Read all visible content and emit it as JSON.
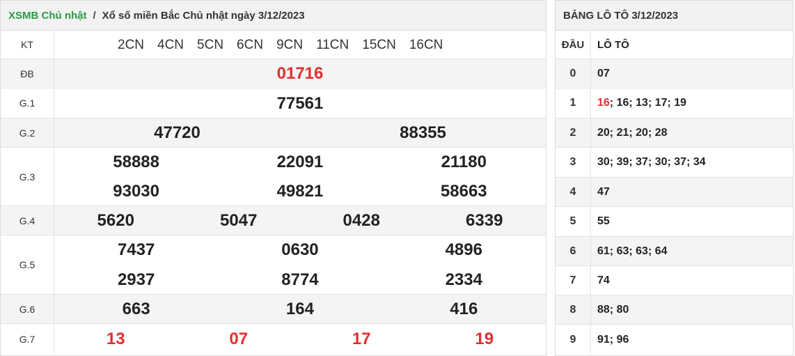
{
  "breadcrumb": {
    "home": "XSMB Chủ nhật",
    "separator": "/",
    "current": "Xổ số miền Bắc Chủ nhật ngày 3/12/2023"
  },
  "results": {
    "kt_label": "KT",
    "kt_codes": [
      "2CN",
      "4CN",
      "5CN",
      "6CN",
      "9CN",
      "11CN",
      "15CN",
      "16CN"
    ],
    "db": {
      "label": "ĐB",
      "values": [
        "01716"
      ]
    },
    "g1": {
      "label": "G.1",
      "values": [
        "77561"
      ]
    },
    "g2": {
      "label": "G.2",
      "values": [
        "47720",
        "88355"
      ]
    },
    "g3": {
      "label": "G.3",
      "values": [
        "58888",
        "22091",
        "21180",
        "93030",
        "49821",
        "58663"
      ]
    },
    "g4": {
      "label": "G.4",
      "values": [
        "5620",
        "5047",
        "0428",
        "6339"
      ]
    },
    "g5": {
      "label": "G.5",
      "values": [
        "7437",
        "0630",
        "4896",
        "2937",
        "8774",
        "2334"
      ]
    },
    "g6": {
      "label": "G.6",
      "values": [
        "663",
        "164",
        "416"
      ]
    },
    "g7": {
      "label": "G.7",
      "values": [
        "13",
        "07",
        "17",
        "19"
      ]
    }
  },
  "loto": {
    "title": "BẢNG LÔ TÔ 3/12/2023",
    "col_dau": "ĐẦU",
    "col_loto": "LÔ TÔ",
    "rows": [
      {
        "dau": "0",
        "highlight": "",
        "rest": "07"
      },
      {
        "dau": "1",
        "highlight": "16",
        "rest": "; 16; 13; 17; 19"
      },
      {
        "dau": "2",
        "highlight": "",
        "rest": "20; 21; 20; 28"
      },
      {
        "dau": "3",
        "highlight": "",
        "rest": "30; 39; 37; 30; 37; 34"
      },
      {
        "dau": "4",
        "highlight": "",
        "rest": "47"
      },
      {
        "dau": "5",
        "highlight": "",
        "rest": "55"
      },
      {
        "dau": "6",
        "highlight": "",
        "rest": "61; 63; 63; 64"
      },
      {
        "dau": "7",
        "highlight": "",
        "rest": "74"
      },
      {
        "dau": "8",
        "highlight": "",
        "rest": "88; 80"
      },
      {
        "dau": "9",
        "highlight": "",
        "rest": "91; 96"
      }
    ]
  },
  "colors": {
    "home_link": "#2a9a47",
    "special": "#e0302f",
    "header_bg": "#f2f2f2"
  }
}
